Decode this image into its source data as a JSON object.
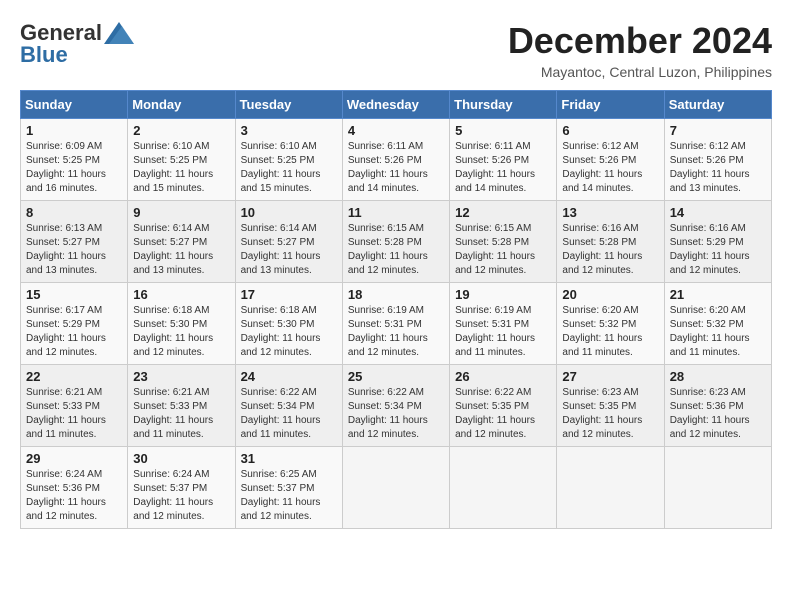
{
  "header": {
    "logo_general": "General",
    "logo_blue": "Blue",
    "month_title": "December 2024",
    "location": "Mayantoc, Central Luzon, Philippines"
  },
  "calendar": {
    "days_of_week": [
      "Sunday",
      "Monday",
      "Tuesday",
      "Wednesday",
      "Thursday",
      "Friday",
      "Saturday"
    ],
    "weeks": [
      [
        {
          "day": "",
          "info": ""
        },
        {
          "day": "2",
          "info": "Sunrise: 6:10 AM\nSunset: 5:25 PM\nDaylight: 11 hours\nand 15 minutes."
        },
        {
          "day": "3",
          "info": "Sunrise: 6:10 AM\nSunset: 5:25 PM\nDaylight: 11 hours\nand 15 minutes."
        },
        {
          "day": "4",
          "info": "Sunrise: 6:11 AM\nSunset: 5:26 PM\nDaylight: 11 hours\nand 14 minutes."
        },
        {
          "day": "5",
          "info": "Sunrise: 6:11 AM\nSunset: 5:26 PM\nDaylight: 11 hours\nand 14 minutes."
        },
        {
          "day": "6",
          "info": "Sunrise: 6:12 AM\nSunset: 5:26 PM\nDaylight: 11 hours\nand 14 minutes."
        },
        {
          "day": "7",
          "info": "Sunrise: 6:12 AM\nSunset: 5:26 PM\nDaylight: 11 hours\nand 13 minutes."
        }
      ],
      [
        {
          "day": "8",
          "info": "Sunrise: 6:13 AM\nSunset: 5:27 PM\nDaylight: 11 hours\nand 13 minutes."
        },
        {
          "day": "9",
          "info": "Sunrise: 6:14 AM\nSunset: 5:27 PM\nDaylight: 11 hours\nand 13 minutes."
        },
        {
          "day": "10",
          "info": "Sunrise: 6:14 AM\nSunset: 5:27 PM\nDaylight: 11 hours\nand 13 minutes."
        },
        {
          "day": "11",
          "info": "Sunrise: 6:15 AM\nSunset: 5:28 PM\nDaylight: 11 hours\nand 12 minutes."
        },
        {
          "day": "12",
          "info": "Sunrise: 6:15 AM\nSunset: 5:28 PM\nDaylight: 11 hours\nand 12 minutes."
        },
        {
          "day": "13",
          "info": "Sunrise: 6:16 AM\nSunset: 5:28 PM\nDaylight: 11 hours\nand 12 minutes."
        },
        {
          "day": "14",
          "info": "Sunrise: 6:16 AM\nSunset: 5:29 PM\nDaylight: 11 hours\nand 12 minutes."
        }
      ],
      [
        {
          "day": "15",
          "info": "Sunrise: 6:17 AM\nSunset: 5:29 PM\nDaylight: 11 hours\nand 12 minutes."
        },
        {
          "day": "16",
          "info": "Sunrise: 6:18 AM\nSunset: 5:30 PM\nDaylight: 11 hours\nand 12 minutes."
        },
        {
          "day": "17",
          "info": "Sunrise: 6:18 AM\nSunset: 5:30 PM\nDaylight: 11 hours\nand 12 minutes."
        },
        {
          "day": "18",
          "info": "Sunrise: 6:19 AM\nSunset: 5:31 PM\nDaylight: 11 hours\nand 12 minutes."
        },
        {
          "day": "19",
          "info": "Sunrise: 6:19 AM\nSunset: 5:31 PM\nDaylight: 11 hours\nand 11 minutes."
        },
        {
          "day": "20",
          "info": "Sunrise: 6:20 AM\nSunset: 5:32 PM\nDaylight: 11 hours\nand 11 minutes."
        },
        {
          "day": "21",
          "info": "Sunrise: 6:20 AM\nSunset: 5:32 PM\nDaylight: 11 hours\nand 11 minutes."
        }
      ],
      [
        {
          "day": "22",
          "info": "Sunrise: 6:21 AM\nSunset: 5:33 PM\nDaylight: 11 hours\nand 11 minutes."
        },
        {
          "day": "23",
          "info": "Sunrise: 6:21 AM\nSunset: 5:33 PM\nDaylight: 11 hours\nand 11 minutes."
        },
        {
          "day": "24",
          "info": "Sunrise: 6:22 AM\nSunset: 5:34 PM\nDaylight: 11 hours\nand 11 minutes."
        },
        {
          "day": "25",
          "info": "Sunrise: 6:22 AM\nSunset: 5:34 PM\nDaylight: 11 hours\nand 12 minutes."
        },
        {
          "day": "26",
          "info": "Sunrise: 6:22 AM\nSunset: 5:35 PM\nDaylight: 11 hours\nand 12 minutes."
        },
        {
          "day": "27",
          "info": "Sunrise: 6:23 AM\nSunset: 5:35 PM\nDaylight: 11 hours\nand 12 minutes."
        },
        {
          "day": "28",
          "info": "Sunrise: 6:23 AM\nSunset: 5:36 PM\nDaylight: 11 hours\nand 12 minutes."
        }
      ],
      [
        {
          "day": "29",
          "info": "Sunrise: 6:24 AM\nSunset: 5:36 PM\nDaylight: 11 hours\nand 12 minutes."
        },
        {
          "day": "30",
          "info": "Sunrise: 6:24 AM\nSunset: 5:37 PM\nDaylight: 11 hours\nand 12 minutes."
        },
        {
          "day": "31",
          "info": "Sunrise: 6:25 AM\nSunset: 5:37 PM\nDaylight: 11 hours\nand 12 minutes."
        },
        {
          "day": "",
          "info": ""
        },
        {
          "day": "",
          "info": ""
        },
        {
          "day": "",
          "info": ""
        },
        {
          "day": "",
          "info": ""
        }
      ]
    ],
    "week0_day1": {
      "day": "1",
      "info": "Sunrise: 6:09 AM\nSunset: 5:25 PM\nDaylight: 11 hours\nand 16 minutes."
    }
  }
}
